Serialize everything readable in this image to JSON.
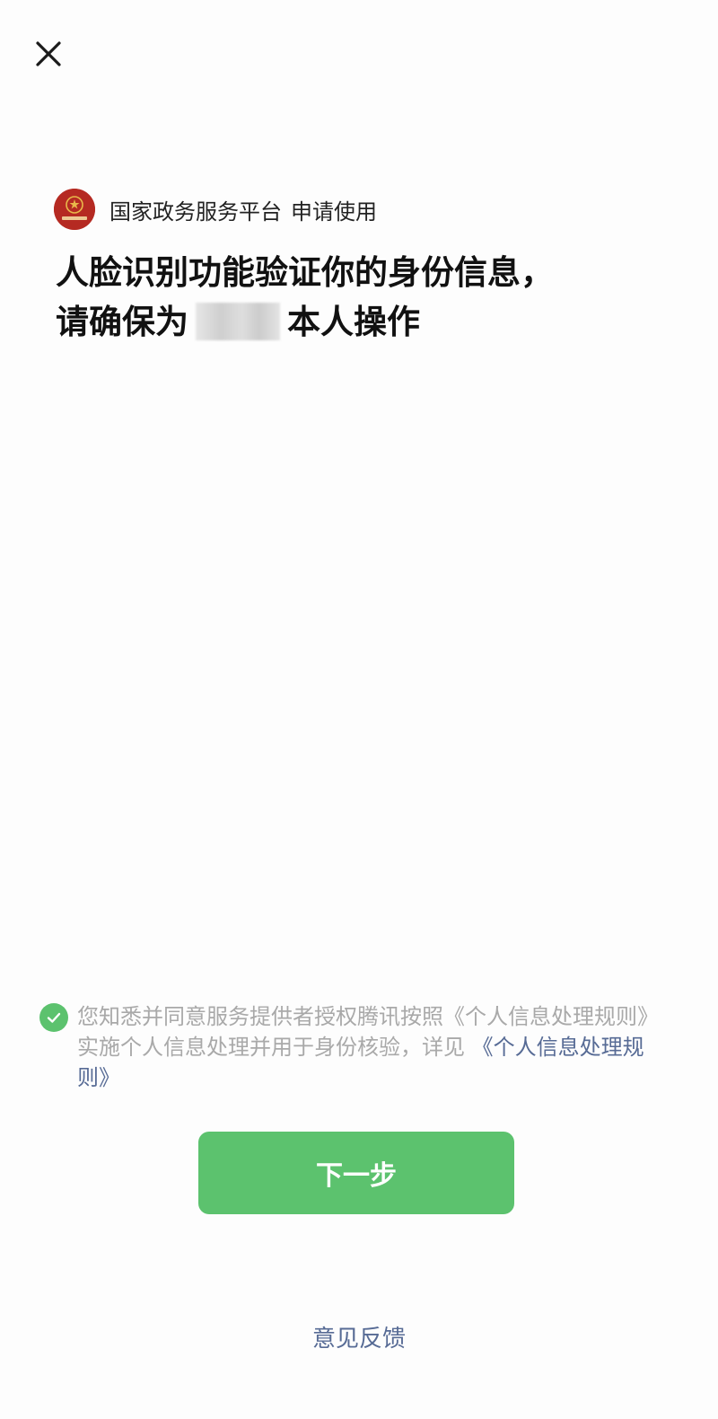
{
  "requester": {
    "platform_name": "国家政务服务平台",
    "request_text": "申请使用"
  },
  "headline": {
    "line1": "人脸识别功能验证你的身份信息，",
    "line2_prefix": "请确保为",
    "line2_suffix": "本人操作"
  },
  "consent": {
    "checked": true,
    "text_before_link": "您知悉并同意服务提供者授权腾讯按照《个人信息处理规则》实施个人信息处理并用于身份核验，详见",
    "link_text": "《个人信息处理规则》"
  },
  "actions": {
    "next_label": "下一步",
    "feedback_label": "意见反馈"
  },
  "icons": {
    "close": "close-icon",
    "check": "checkmark-icon",
    "emblem": "national-emblem-logo"
  },
  "colors": {
    "accent_green": "#5cc26e",
    "link_blue": "#576b95",
    "muted_text": "#a9a9a9",
    "emblem_red": "#b52a22"
  }
}
